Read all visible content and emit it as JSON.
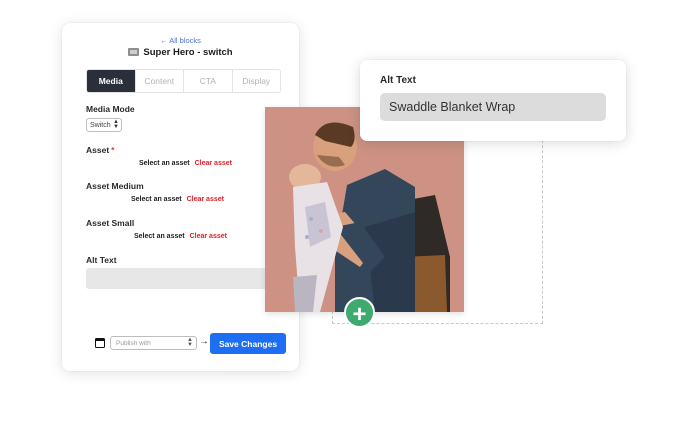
{
  "editor": {
    "back_link": "← All blocks",
    "block_title": "Super Hero - switch",
    "tabs": [
      {
        "label": "Media",
        "active": true
      },
      {
        "label": "Content",
        "active": false
      },
      {
        "label": "CTA",
        "active": false
      },
      {
        "label": "Display",
        "active": false
      }
    ],
    "media_mode": {
      "label": "Media Mode",
      "value": "Switch"
    },
    "asset": {
      "label": "Asset",
      "required_mark": "*",
      "select_label": "Select an asset",
      "clear_label": "Clear asset"
    },
    "asset_medium": {
      "label": "Asset Medium",
      "select_label": "Select an asset",
      "clear_label": "Clear asset"
    },
    "asset_small": {
      "label": "Asset Small",
      "select_label": "Select an asset",
      "clear_label": "Clear asset"
    },
    "alt_text": {
      "label": "Alt Text",
      "value": ""
    },
    "footer": {
      "publish_placeholder": "Publish with",
      "arrow": "→",
      "save_label": "Save Changes"
    }
  },
  "alt_card": {
    "label": "Alt Text",
    "value": "Swaddle Blanket Wrap"
  },
  "add_button": {
    "symbol": "+"
  },
  "colors": {
    "primary": "#1d6ef2",
    "tab_active": "#2b2f3a",
    "danger": "#e0202a",
    "add": "#3daa6f",
    "link": "#4a6fd8"
  },
  "icons": [
    "block-icon",
    "calendar-icon",
    "plus-icon"
  ]
}
